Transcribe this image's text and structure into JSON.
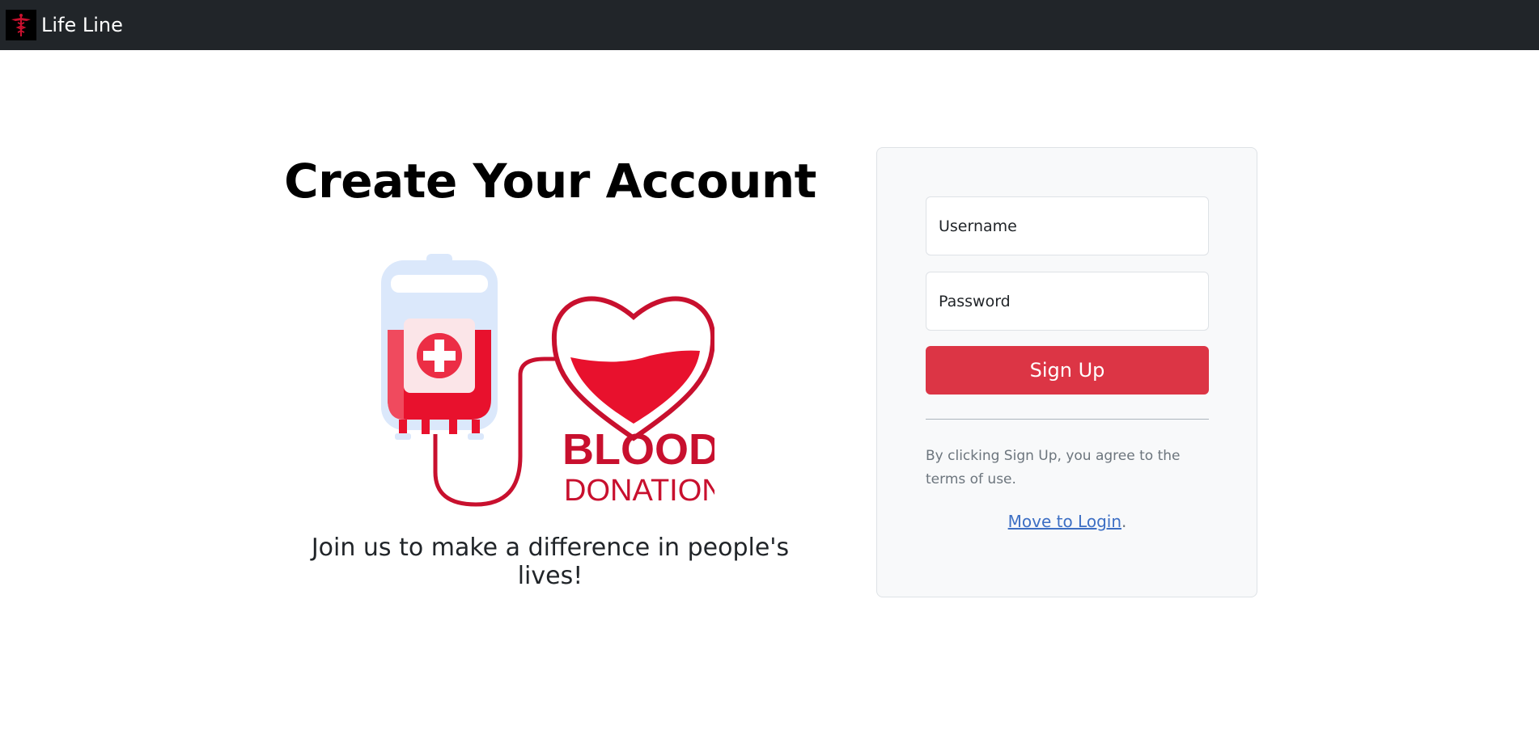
{
  "navbar": {
    "brand_name": "Life Line",
    "logo_icon": "caduceus-icon"
  },
  "hero": {
    "title": "Create Your Account",
    "illustration": {
      "icon": "blood-bag-heart-icon",
      "text_line1": "BLOOD",
      "text_line2": "DONATION"
    },
    "tagline": "Join us to make a difference in people's lives!"
  },
  "form": {
    "username_placeholder": "Username",
    "password_placeholder": "Password",
    "signup_label": "Sign Up",
    "terms_text": "By clicking Sign Up, you agree to the terms of use.",
    "login_link_label": "Move to Login",
    "login_suffix": "."
  },
  "colors": {
    "navbar_bg": "#212529",
    "primary_red": "#dc3545",
    "illustration_red": "#c8102e",
    "link_blue": "#3d6fc4"
  }
}
